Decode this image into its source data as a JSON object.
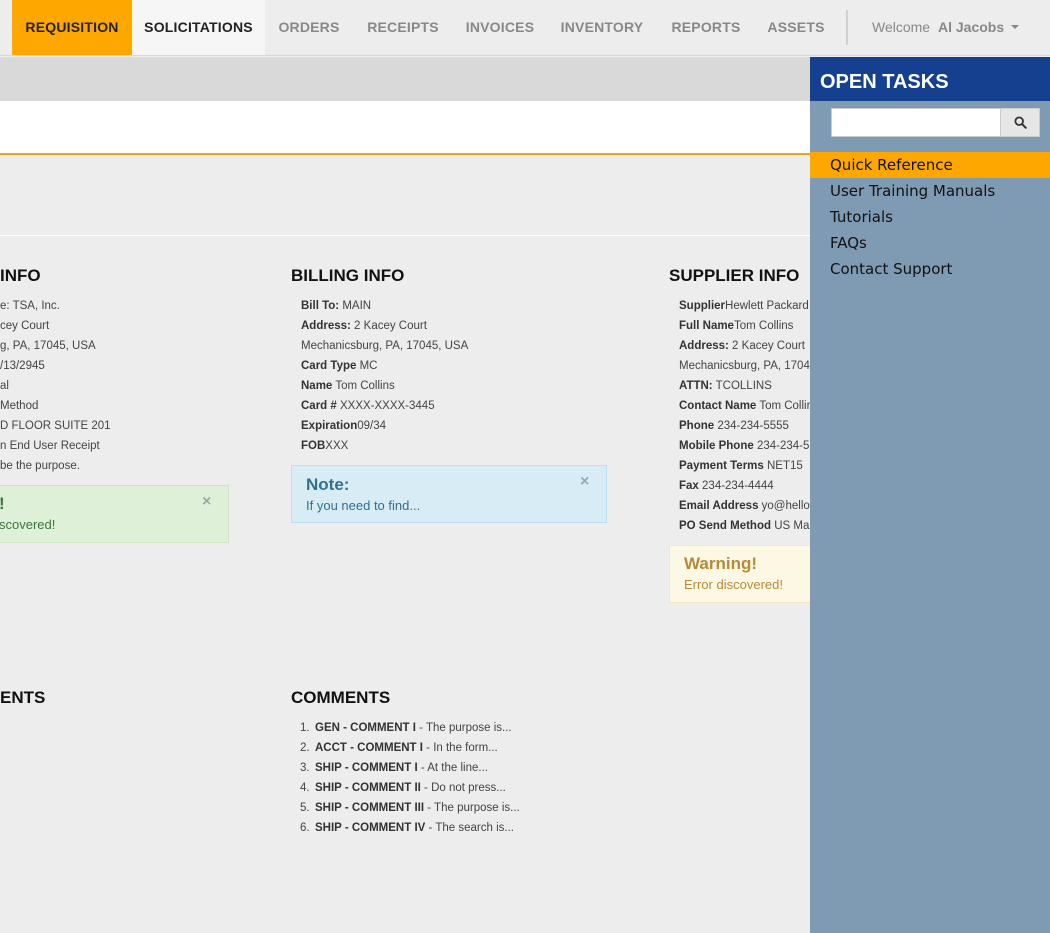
{
  "nav": {
    "tabs": [
      {
        "label": "REQUISITION"
      },
      {
        "label": "SOLICITATIONS"
      },
      {
        "label": "ORDERS"
      },
      {
        "label": "RECEIPTS"
      },
      {
        "label": "INVOICES"
      },
      {
        "label": "INVENTORY"
      },
      {
        "label": "REPORTS"
      },
      {
        "label": "ASSETS"
      }
    ],
    "welcome": "Welcome",
    "user": "Al Jacobs"
  },
  "shipping": {
    "title_partial": "INFO",
    "rows": [
      "e: TSA, Inc.",
      "cey Court",
      "g, PA, 17045, USA",
      "/13/2945",
      "al",
      "Method",
      "D FLOOR SUITE 201",
      "n End User Receipt",
      "be the purpose."
    ],
    "alert": {
      "title": "!",
      "text": "scovered!"
    }
  },
  "billing": {
    "title": "BILLING INFO",
    "rows": [
      {
        "label": "Bill To:",
        "value": " MAIN"
      },
      {
        "label": "Address:",
        "value": " 2 Kacey Court"
      },
      {
        "label": "",
        "value": "Mechanicsburg, PA, 17045, USA"
      },
      {
        "label": "Card Type",
        "value": " MC"
      },
      {
        "label": "Name",
        "value": " Tom Collins"
      },
      {
        "label": "Card #",
        "value": " XXXX-XXXX-3445"
      },
      {
        "label": "Expiration",
        "value": "09/34"
      },
      {
        "label": "FOB",
        "value": "XXX"
      }
    ],
    "alert": {
      "title": "Note:",
      "text": "If you need to find..."
    }
  },
  "supplier": {
    "title": "SUPPLIER INFO",
    "rows": [
      {
        "label": "Supplier",
        "value": "Hewlett Packard"
      },
      {
        "label": "Full Name",
        "value": "Tom Collins"
      },
      {
        "label": "Address:",
        "value": " 2 Kacey Court"
      },
      {
        "label": "",
        "value": "Mechanicsburg, PA, 1704"
      },
      {
        "label": "ATTN:",
        "value": " TCOLLINS"
      },
      {
        "label": "Contact Name",
        "value": " Tom Collir"
      },
      {
        "label": "Phone",
        "value": " 234-234-5555"
      },
      {
        "label": "Mobile Phone",
        "value": " 234-234-5"
      },
      {
        "label": "Payment Terms",
        "value": " NET15"
      },
      {
        "label": "Fax",
        "value": " 234-234-4444"
      },
      {
        "label": "Email Address",
        "value": " yo@hello.c"
      },
      {
        "label": "PO Send Method",
        "value": " US Mai"
      }
    ],
    "alert": {
      "title": "Warning!",
      "text": "Error discovered!"
    }
  },
  "comments_left": {
    "title_partial": "ENTS"
  },
  "comments": {
    "title": "COMMENTS",
    "items": [
      {
        "num": "1.",
        "label": "GEN - COMMENT I",
        "text": " - The purpose is..."
      },
      {
        "num": "2.",
        "label": "ACCT - COMMENT I",
        "text": " - In the form..."
      },
      {
        "num": "3.",
        "label": "SHIP - COMMENT I",
        "text": " - At the line..."
      },
      {
        "num": "4.",
        "label": "SHIP - COMMENT II",
        "text": " - Do not press..."
      },
      {
        "num": "5.",
        "label": "SHIP - COMMENT III",
        "text": " - The purpose is..."
      },
      {
        "num": "6.",
        "label": "SHIP - COMMENT IV",
        "text": " - The search is..."
      }
    ]
  },
  "panel": {
    "title": "OPEN TASKS",
    "search_placeholder": "",
    "menu": [
      {
        "label": "Quick Reference"
      },
      {
        "label": "User Training Manuals"
      },
      {
        "label": "Tutorials"
      },
      {
        "label": "FAQs"
      },
      {
        "label": "Contact Support"
      }
    ]
  },
  "colors": {
    "accent": "#fea700",
    "panel_header": "#15408f",
    "panel_bg": "#7f9bb3"
  }
}
